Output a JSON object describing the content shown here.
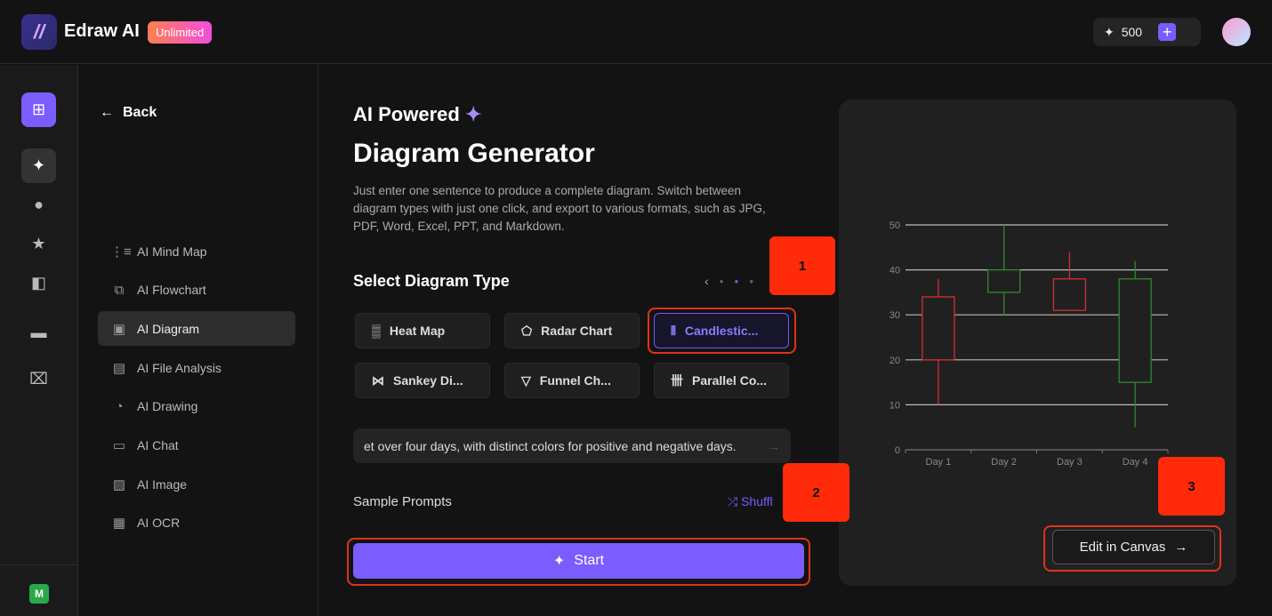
{
  "app": {
    "name": "Edraw AI",
    "badge": "Unlimited",
    "credits": "500",
    "plus": "+",
    "avatar_icon": "user-icon"
  },
  "rail": {
    "items": [
      "new-icon",
      "sparkle-icon",
      "clock-icon",
      "star-icon",
      "template-icon",
      "folder-icon",
      "trash-icon"
    ],
    "user_initial": "M"
  },
  "side": {
    "back": "Back",
    "items": [
      {
        "label": "AI Mind Map",
        "icon": "⋮≡"
      },
      {
        "label": "AI Flowchart",
        "icon": "⧉"
      },
      {
        "label": "AI Diagram",
        "icon": "▣",
        "active": true
      },
      {
        "label": "AI File Analysis",
        "icon": "▤"
      },
      {
        "label": "AI Drawing",
        "icon": "◔"
      },
      {
        "label": "AI Chat",
        "icon": "▭"
      },
      {
        "label": "AI Image",
        "icon": "▨"
      },
      {
        "label": "AI OCR",
        "icon": "▦"
      }
    ]
  },
  "main": {
    "eyebrow": "AI Powered",
    "title": "Diagram Generator",
    "desc": "Just enter one sentence to produce a complete diagram. Switch between diagram types with just one click, and export to various formats, such as JPG, PDF, Word, Excel, PPT, and Markdown.",
    "select_title": "Select Diagram Type",
    "types": [
      {
        "label": "Heat Map",
        "icon": "▒"
      },
      {
        "label": "Radar Chart",
        "icon": "⬠"
      },
      {
        "label": "Candlestic...",
        "icon": "⫴",
        "selected": true
      },
      {
        "label": "Sankey Di...",
        "icon": "⋈"
      },
      {
        "label": "Funnel Ch...",
        "icon": "▽"
      },
      {
        "label": "Parallel Co...",
        "icon": "卌"
      }
    ],
    "prompt": "et over four days, with distinct colors for positive and negative days.",
    "sample_prompts": "Sample Prompts",
    "shuffle": "Shuffl",
    "start": "Start"
  },
  "preview": {
    "edit": "Edit in Canvas"
  },
  "annotations": [
    "1",
    "2",
    "3"
  ],
  "colors": {
    "accent": "#7b5cff",
    "up": "#2e8b2e",
    "down": "#d03030",
    "annotation": "#ff2a0a"
  },
  "chart_data": {
    "type": "candlestick",
    "categories": [
      "Day 1",
      "Day 2",
      "Day 3",
      "Day 4"
    ],
    "yticks": [
      "0",
      "10",
      "20",
      "30",
      "40",
      "50"
    ],
    "ylim": [
      0,
      50
    ],
    "grid": true,
    "series": [
      {
        "open": 34,
        "close": 20,
        "high": 38,
        "low": 10
      },
      {
        "open": 35,
        "close": 40,
        "high": 50,
        "low": 30
      },
      {
        "open": 38,
        "close": 31,
        "high": 44,
        "low": 31
      },
      {
        "open": 15,
        "close": 38,
        "high": 42,
        "low": 5
      }
    ]
  }
}
